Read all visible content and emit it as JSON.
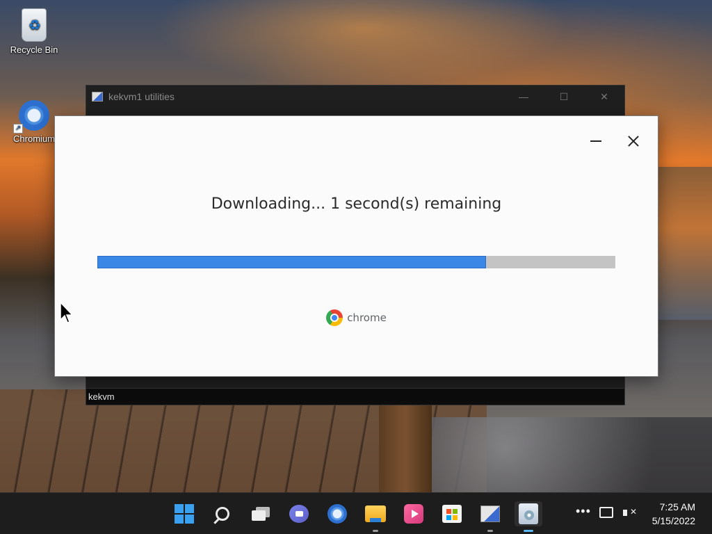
{
  "desktop": {
    "icons": [
      {
        "label": "Recycle Bin",
        "icon": "recycle-bin-icon"
      },
      {
        "label": "Chromium",
        "icon": "chromium-icon"
      }
    ]
  },
  "utility_window": {
    "title": "kekvm1 utilities",
    "controls": {
      "minimize": "—",
      "maximize": "☐",
      "close": "✕"
    },
    "status_bar": "kekvm"
  },
  "installer": {
    "status_text": "Downloading... 1 second(s) remaining",
    "progress_percent": 75,
    "brand": "chrome",
    "colors": {
      "progress_fill": "#3b87e6",
      "progress_track": "#c4c4c4"
    }
  },
  "taskbar": {
    "apps": [
      {
        "name": "Start",
        "icon": "windows-start-icon"
      },
      {
        "name": "Search",
        "icon": "search-icon"
      },
      {
        "name": "Task View",
        "icon": "task-view-icon"
      },
      {
        "name": "Chat",
        "icon": "chat-icon"
      },
      {
        "name": "Chromium",
        "icon": "chromium-icon"
      },
      {
        "name": "File Explorer",
        "icon": "folder-icon"
      },
      {
        "name": "Media",
        "icon": "media-player-icon"
      },
      {
        "name": "Microsoft Store",
        "icon": "store-icon"
      },
      {
        "name": "kekvm1 utilities",
        "icon": "kvm-utilities-icon"
      },
      {
        "name": "Setup",
        "icon": "setup-icon"
      }
    ],
    "tray": {
      "overflow": "•••",
      "time": "7:25 AM",
      "date": "5/15/2022"
    }
  }
}
